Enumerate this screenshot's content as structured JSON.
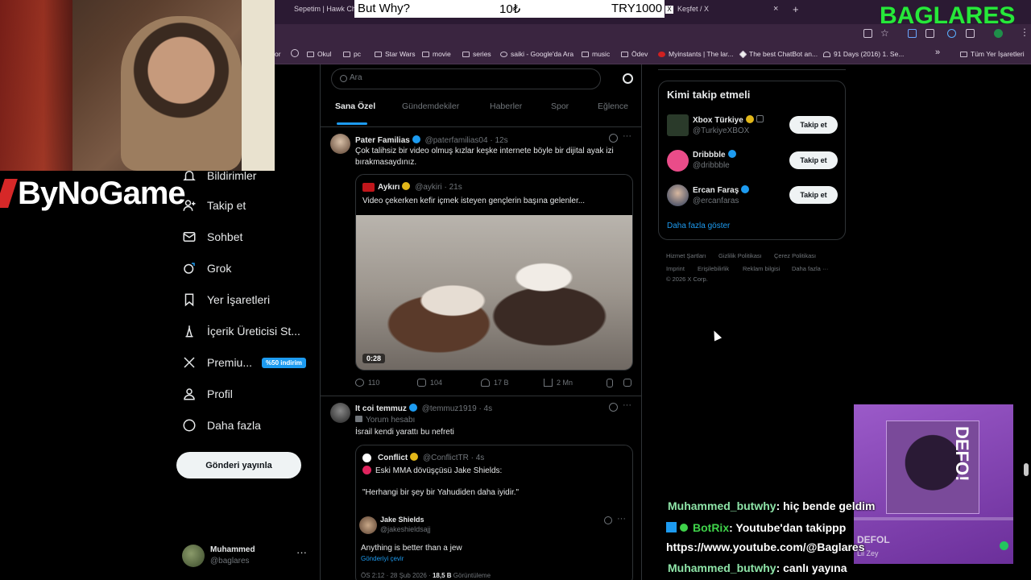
{
  "browser": {
    "tabs": [
      {
        "label": "Sepetim | Hawk Chair"
      },
      {
        "label": "Keşfet / X",
        "close": "×"
      }
    ],
    "new_tab": "+",
    "bookmarks": [
      "Okul",
      "pc",
      "Star Wars",
      "movie",
      "series",
      "saiki - Google'da Ara",
      "music",
      "Ödev",
      "Myinstants | The lar...",
      "The best ChatBot an...",
      "91 Days (2016) 1. Se..."
    ],
    "bookmarks_overflow": "»",
    "all_bookmarks": "Tüm Yer İşaretleri",
    "bookmark_prefix": "or"
  },
  "overlay": {
    "bet_title": "But Why?",
    "bet_amount": "10₺",
    "bet_goal": "TRY1000",
    "channel_logo": "BAGLARES",
    "sponsor": "ByNoGame"
  },
  "nav": {
    "items": [
      {
        "label": "Bildirimler",
        "icon": "bell-icon"
      },
      {
        "label": "Takip et",
        "icon": "follow-icon"
      },
      {
        "label": "Sohbet",
        "icon": "mail-icon"
      },
      {
        "label": "Grok",
        "icon": "grok-icon"
      },
      {
        "label": "Yer İşaretleri",
        "icon": "bookmark-icon"
      },
      {
        "label": "İçerik Üreticisi St...",
        "icon": "creator-icon"
      },
      {
        "label": "Premiu...",
        "icon": "x-logo-icon",
        "badge": "%50 indirim"
      },
      {
        "label": "Profil",
        "icon": "person-icon"
      },
      {
        "label": "Daha fazla",
        "icon": "more-circle-icon"
      }
    ],
    "post_button": "Gönderi yayınla",
    "account": {
      "name": "Muhammed",
      "handle": "@baglares",
      "more": "···"
    }
  },
  "explore": {
    "search_placeholder": "Ara",
    "tabs": [
      "Sana Özel",
      "Gündemdekiler",
      "Haberler",
      "Spor",
      "Eğlence"
    ],
    "active_tab": "Sana Özel"
  },
  "tweets": [
    {
      "name": "Pater Familias",
      "handle": "@paterfamilias04",
      "time": "· 12s",
      "text": "Çok talihsiz bir video olmuş kızlar keşke internete böyle bir dijital ayak izi bırakmasaydınız.",
      "quote": {
        "name": "Aykırı",
        "handle": "@aykiri",
        "time": "· 21s",
        "text": "Video çekerken kefir içmek isteyen gençlerin başına gelenler...",
        "video_duration": "0:28"
      },
      "replies": "110",
      "reposts": "104",
      "likes": "17 B",
      "views": "2 Mn"
    },
    {
      "name": "It coi temmuz",
      "handle": "@temmuz1919",
      "time": "· 4s",
      "sublabel": "Yorum hesabı",
      "text": "İsrail kendi yarattı bu nefreti",
      "quote": {
        "name": "Conflict",
        "handle": "@ConflictTR",
        "time": "· 4s",
        "line1": "Eski MMA dövüşçüsü Jake Shields:",
        "line2": "\"Herhangi bir şey bir Yahudiden daha iyidir.\"",
        "inner": {
          "name": "Jake Shields",
          "handle": "@jakeshieldsajj",
          "text": "Anything is better than a jew",
          "translate": "Gönderiyi çevir",
          "meta_time": "ÖS 2:12 · 28 Şub 2026 ·",
          "meta_views": "18,5 B",
          "meta_views_label": "Görüntüleme"
        }
      }
    }
  ],
  "who_to_follow": {
    "title": "Kimi takip etmeli",
    "users": [
      {
        "name": "Xbox Türkiye",
        "handle": "@TurkiyeXBOX",
        "button": "Takip et"
      },
      {
        "name": "Dribbble",
        "handle": "@dribbble",
        "button": "Takip et"
      },
      {
        "name": "Ercan Faraş",
        "handle": "@ercanfaras",
        "button": "Takip et"
      }
    ],
    "show_more": "Daha fazla göster"
  },
  "footer": {
    "links": [
      "Hizmet Şartları",
      "Gizlilik Politikası",
      "Çerez Politikası",
      "Imprint",
      "Erişilebilirlik",
      "Reklam bilgisi",
      "Daha fazla ···"
    ],
    "copyright": "© 2026 X Corp."
  },
  "now_playing": {
    "art_text": "DEFO!",
    "title": "DEFOL",
    "artist": "Lil Zey"
  },
  "chat": [
    {
      "user": "Muhammed_butwhy",
      "message": ": hiç bende geldim"
    },
    {
      "user": "BotRix",
      "message": ": Youtube'dan takippp"
    },
    {
      "user": "",
      "message": "https://www.youtube.com/@Baglares"
    },
    {
      "user": "Muhammed_butwhy",
      "message": ": canlı yayına"
    }
  ],
  "colors": {
    "accent": "#1d9bf0",
    "background": "#000000",
    "overlay_green": "#27e83a",
    "now_playing_purple": "#9b5ac9"
  }
}
